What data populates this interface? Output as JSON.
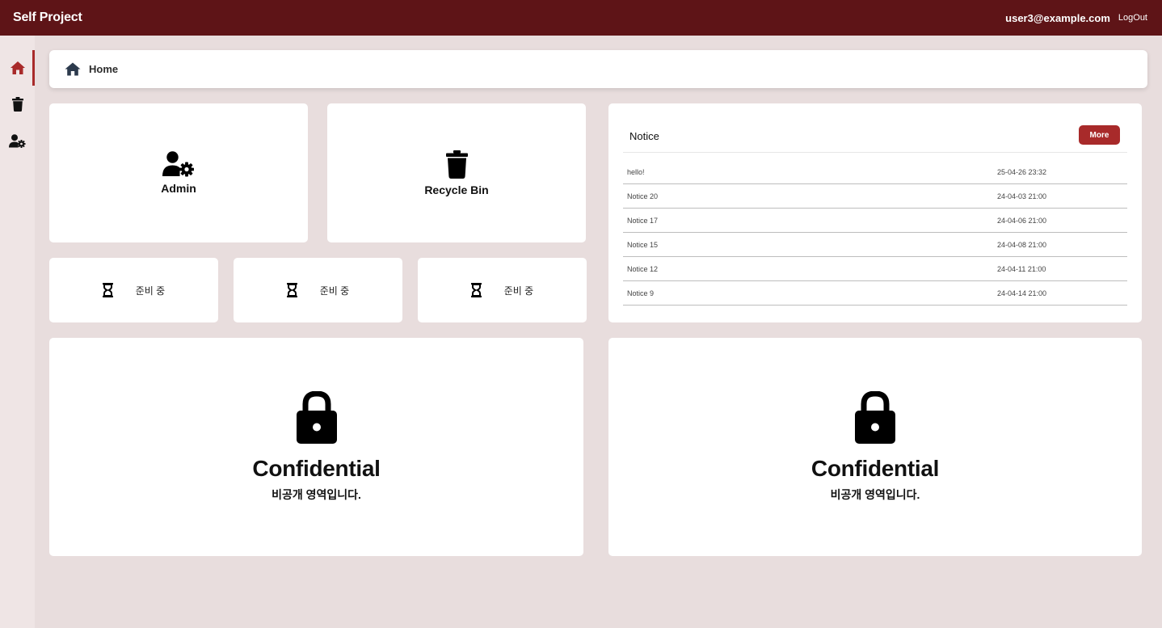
{
  "header": {
    "brand": "Self Project",
    "user_email": "user3@example.com",
    "logout_label": "LogOut",
    "bg_color": "#5e1417"
  },
  "sidebar": {
    "items": [
      {
        "icon": "home-icon",
        "active": true
      },
      {
        "icon": "trash-icon",
        "active": false
      },
      {
        "icon": "user-gear-icon",
        "active": false
      }
    ],
    "accent_color": "#a82a2a"
  },
  "breadcrumb": {
    "icon": "home-icon",
    "label": "Home"
  },
  "tiles": {
    "admin": {
      "icon": "user-gear-icon",
      "label": "Admin"
    },
    "recycle": {
      "icon": "trash-icon",
      "label": "Recycle Bin"
    }
  },
  "pending": [
    {
      "icon": "hourglass-icon",
      "label": "준비 중"
    },
    {
      "icon": "hourglass-icon",
      "label": "준비 중"
    },
    {
      "icon": "hourglass-icon",
      "label": "준비 중"
    }
  ],
  "notice": {
    "title": "Notice",
    "more_label": "More",
    "rows": [
      {
        "title": "hello!",
        "date": "25-04-26 23:32"
      },
      {
        "title": "Notice 20",
        "date": "24-04-03 21:00"
      },
      {
        "title": "Notice 17",
        "date": "24-04-06 21:00"
      },
      {
        "title": "Notice 15",
        "date": "24-04-08 21:00"
      },
      {
        "title": "Notice 12",
        "date": "24-04-11 21:00"
      },
      {
        "title": "Notice 9",
        "date": "24-04-14 21:00"
      }
    ]
  },
  "confidential": [
    {
      "icon": "lock-icon",
      "title": "Confidential",
      "subtitle": "비공개 영역입니다."
    },
    {
      "icon": "lock-icon",
      "title": "Confidential",
      "subtitle": "비공개 영역입니다."
    }
  ]
}
